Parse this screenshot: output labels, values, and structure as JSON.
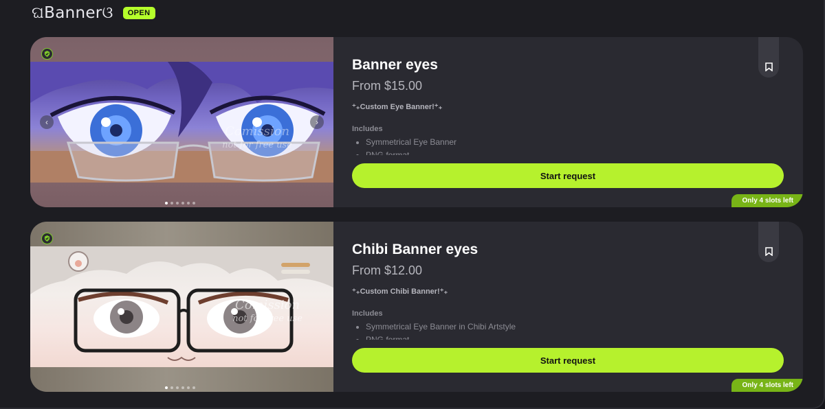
{
  "section": {
    "title": "ଘBannerଓ",
    "status_badge": "OPEN"
  },
  "cards": [
    {
      "title": "Banner eyes",
      "price": "From $15.00",
      "tagline": "⁺₊Custom Eye Banner!⁺₊",
      "includes_label": "Includes",
      "includes": [
        "Symmetrical Eye Banner",
        "PNG format"
      ],
      "button_label": "Start request",
      "slots_badge": "Only 4 slots left",
      "image_watermark": [
        "Comission",
        "not for free use"
      ],
      "carousel_dots": 6,
      "active_dot": 0
    },
    {
      "title": "Chibi Banner eyes",
      "price": "From $12.00",
      "tagline": "⁺₊Custom Chibi Banner!⁺₊",
      "includes_label": "Includes",
      "includes": [
        "Symmetrical Eye Banner in Chibi Artstyle",
        "PNG format"
      ],
      "button_label": "Start request",
      "slots_badge": "Only 4 slots left",
      "image_watermark": [
        "Comission",
        "not for free use"
      ],
      "carousel_dots": 6,
      "active_dot": 0
    }
  ],
  "colors": {
    "accent": "#b6f12d",
    "badge_green": "#78b417",
    "card_bg": "#2a2a31",
    "page_bg": "#1d1d22"
  },
  "icons": {
    "verified": "verified-check-icon",
    "bookmark": "bookmark-icon",
    "prev": "chevron-left-icon",
    "next": "chevron-right-icon"
  }
}
